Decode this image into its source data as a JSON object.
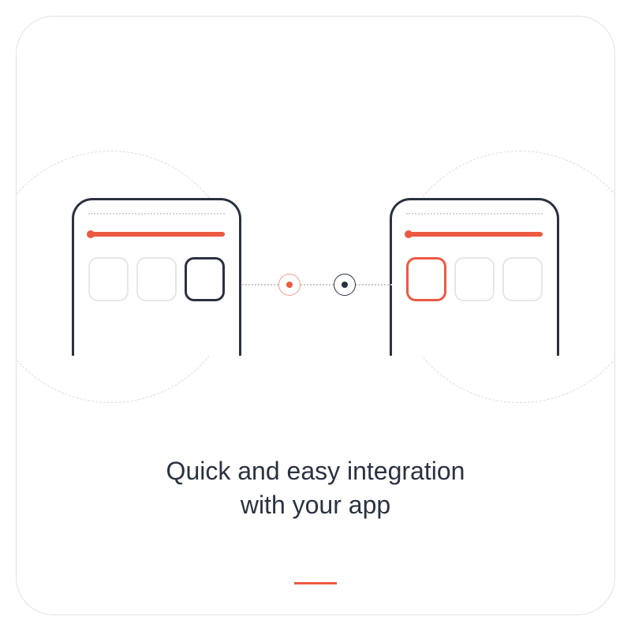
{
  "heading": {
    "line1": "Quick and easy integration",
    "line2": "with your app"
  },
  "colors": {
    "accent": "#ec5a42",
    "dark": "#2a3240",
    "muted_border": "#e6e6e6"
  },
  "illustration": {
    "left_phone_tiles": [
      "muted",
      "muted",
      "dark"
    ],
    "right_phone_tiles": [
      "accent",
      "muted",
      "muted"
    ],
    "connection_nodes": [
      "accent",
      "dark"
    ]
  }
}
